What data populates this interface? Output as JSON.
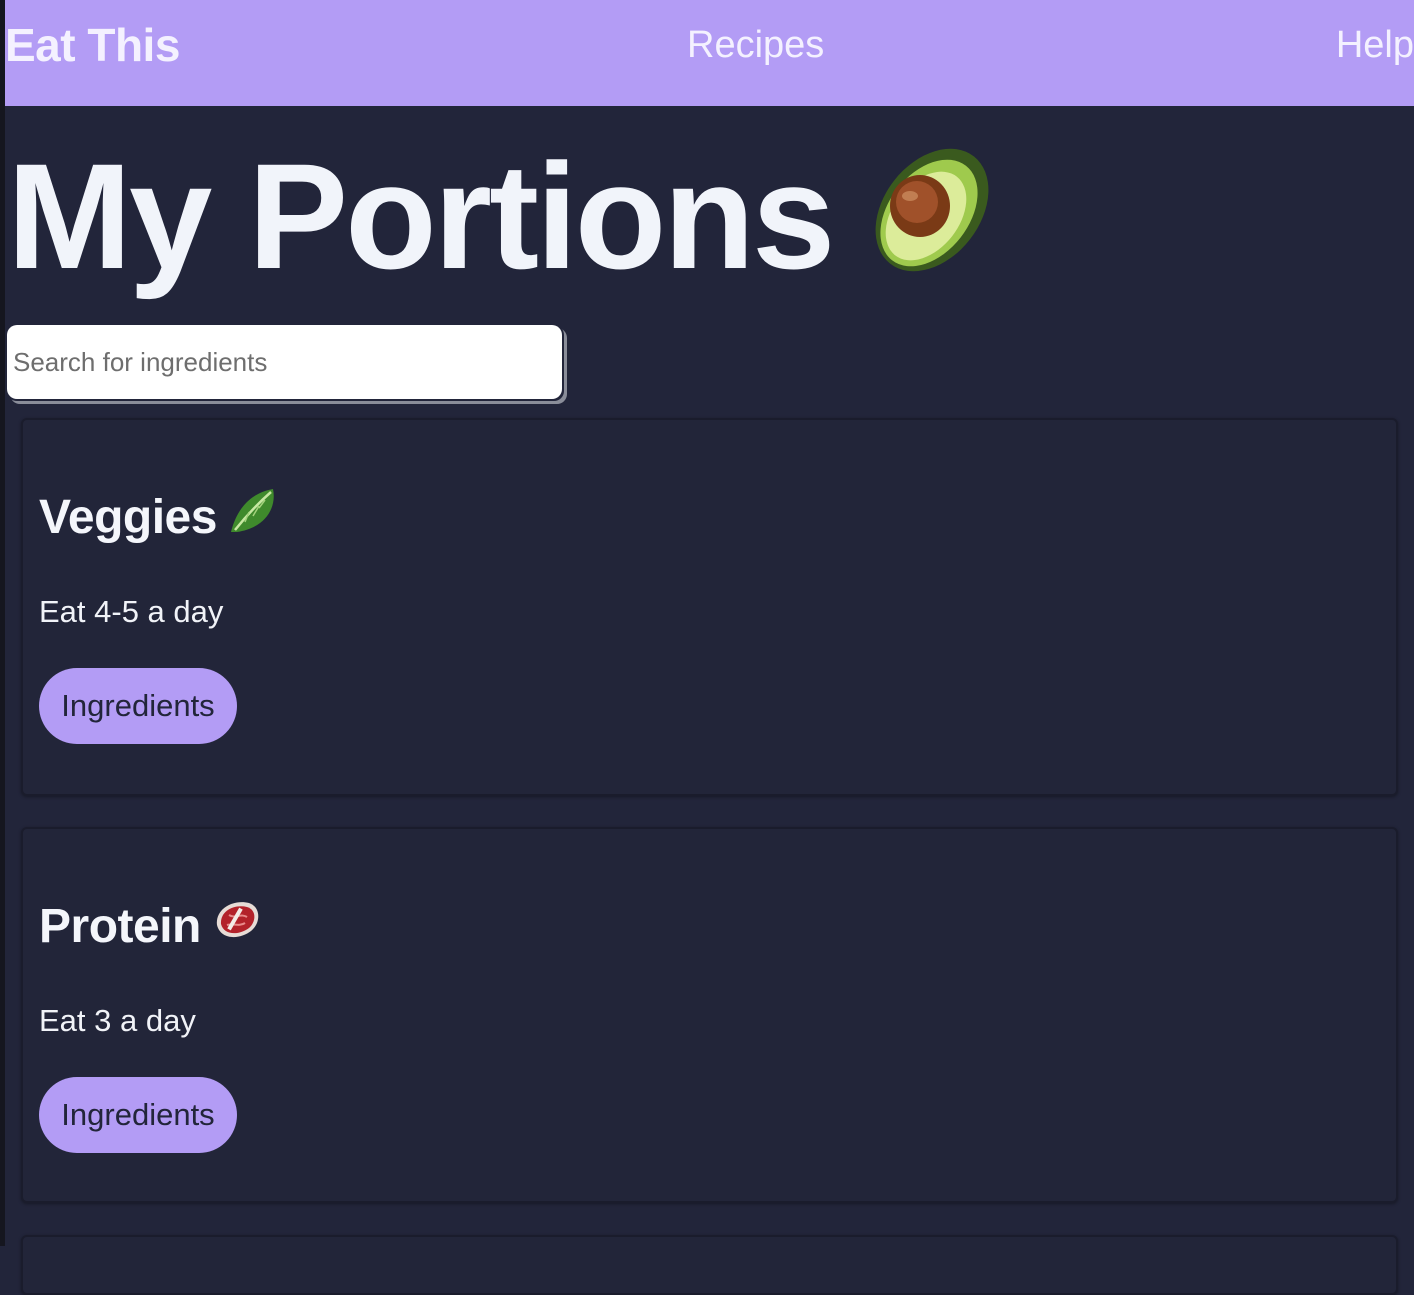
{
  "nav": {
    "brand": "Eat This",
    "links": [
      {
        "label": "Recipes"
      },
      {
        "label": "Help"
      }
    ],
    "background": "#b39cf5"
  },
  "header": {
    "title": "My Portions",
    "icon": "avocado-icon"
  },
  "search": {
    "placeholder": "Search for ingredients",
    "value": ""
  },
  "portions": [
    {
      "name": "Veggies",
      "icon": "leafy-green-icon",
      "guidance": "Eat 4-5 a day",
      "button_label": "Ingredients"
    },
    {
      "name": "Protein",
      "icon": "steak-icon",
      "guidance": "Eat 3 a day",
      "button_label": "Ingredients"
    }
  ],
  "colors": {
    "accent": "#b39cf5",
    "background": "#22253a",
    "text": "#f1f4fa"
  }
}
